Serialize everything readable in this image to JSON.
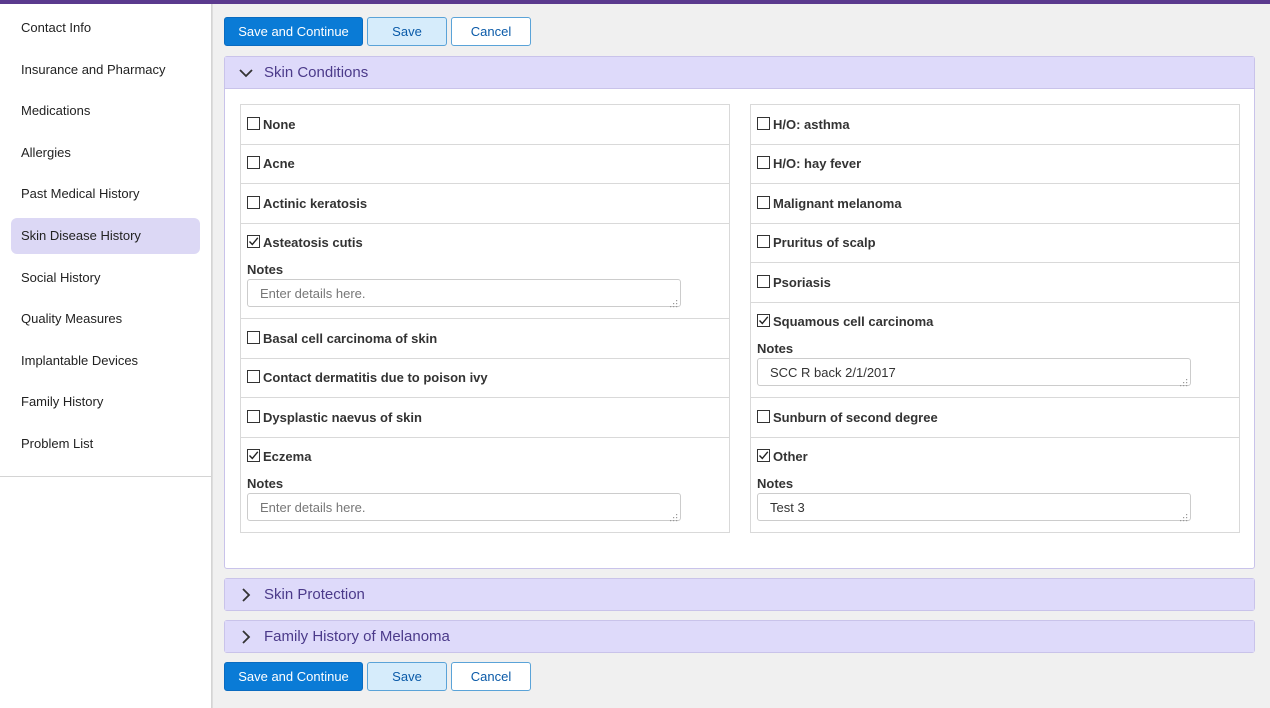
{
  "sidebar": {
    "items": [
      {
        "label": "Contact Info",
        "active": false
      },
      {
        "label": "Insurance and Pharmacy",
        "active": false
      },
      {
        "label": "Medications",
        "active": false
      },
      {
        "label": "Allergies",
        "active": false
      },
      {
        "label": "Past Medical History",
        "active": false
      },
      {
        "label": "Skin Disease History",
        "active": true
      },
      {
        "label": "Social History",
        "active": false
      },
      {
        "label": "Quality Measures",
        "active": false
      },
      {
        "label": "Implantable Devices",
        "active": false
      },
      {
        "label": "Family History",
        "active": false
      },
      {
        "label": "Problem List",
        "active": false
      }
    ]
  },
  "buttons": {
    "save_continue": "Save and Continue",
    "save": "Save",
    "cancel": "Cancel"
  },
  "sections": {
    "skin_conditions": {
      "title": "Skin Conditions",
      "expanded": true,
      "notes_label": "Notes",
      "placeholder": "Enter details here.",
      "left": [
        {
          "label": "None",
          "checked": false
        },
        {
          "label": "Acne",
          "checked": false
        },
        {
          "label": "Actinic keratosis",
          "checked": false
        },
        {
          "label": "Asteatosis cutis",
          "checked": true,
          "note": ""
        },
        {
          "label": "Basal cell carcinoma of skin",
          "checked": false
        },
        {
          "label": "Contact dermatitis due to poison ivy",
          "checked": false
        },
        {
          "label": "Dysplastic naevus of skin",
          "checked": false
        },
        {
          "label": "Eczema",
          "checked": true,
          "note": ""
        }
      ],
      "right": [
        {
          "label": "H/O: asthma",
          "checked": false
        },
        {
          "label": "H/O: hay fever",
          "checked": false
        },
        {
          "label": "Malignant melanoma",
          "checked": false
        },
        {
          "label": "Pruritus of scalp",
          "checked": false
        },
        {
          "label": "Psoriasis",
          "checked": false
        },
        {
          "label": "Squamous cell carcinoma",
          "checked": true,
          "note": "SCC R back 2/1/2017"
        },
        {
          "label": "Sunburn of second degree",
          "checked": false
        },
        {
          "label": "Other",
          "checked": true,
          "note": "Test 3"
        }
      ]
    },
    "skin_protection": {
      "title": "Skin Protection",
      "expanded": false
    },
    "family_melanoma": {
      "title": "Family History of Melanoma",
      "expanded": false
    }
  },
  "icons": {
    "expanded": "chevron-down-icon",
    "collapsed": "chevron-right-icon",
    "checkbox_checked": "checkmark-icon",
    "resize": "resize-grip-icon"
  },
  "colors": {
    "accent": "#5b3a8e",
    "panel_header": "#dedafa",
    "primary_button": "#0a7bd6",
    "sidebar_active": "#dcd8f5"
  }
}
